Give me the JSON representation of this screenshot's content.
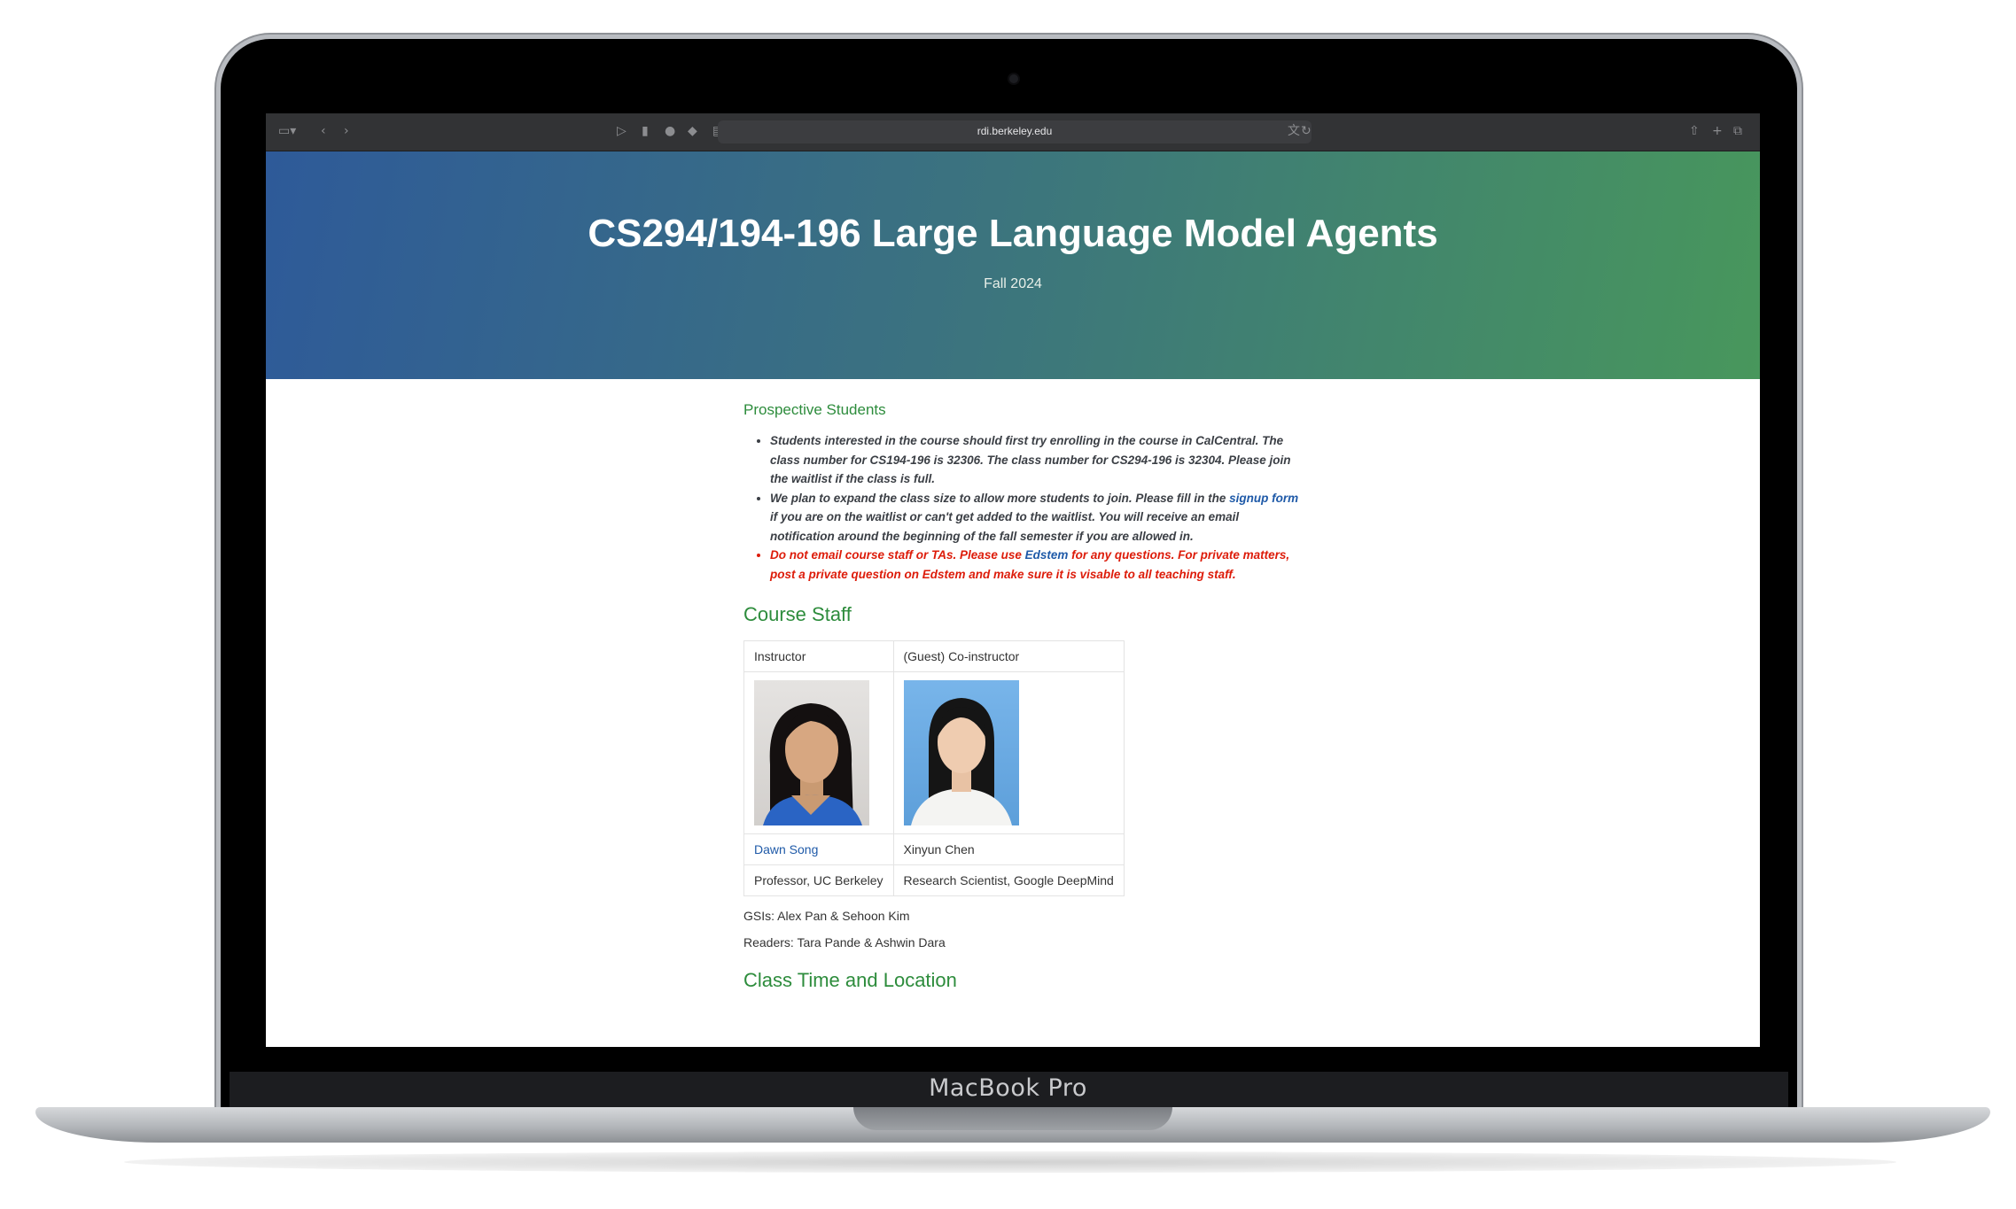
{
  "device": {
    "brand": "MacBook Pro"
  },
  "browser": {
    "url": "rdi.berkeley.edu",
    "icons": [
      "sidebar-icon",
      "chevron-left-icon",
      "chevron-right-icon",
      "tab-icon",
      "page-icon",
      "shield-icon",
      "extension-icon",
      "tab-overview-icon",
      "translate-icon",
      "reload-icon",
      "share-icon",
      "new-tab-icon",
      "tabs-icon"
    ]
  },
  "header": {
    "title": "CS294/194-196 Large Language Model Agents",
    "subtitle": "Fall 2024"
  },
  "prospective": {
    "heading": "Prospective Students",
    "item1": "Students interested in the course should first try enrolling in the course in CalCentral. The class number for CS194-196 is 32306. The class number for CS294-196 is 32304. Please join the waitlist if the class is full.",
    "item2_before": "We plan to expand the class size to allow more students to join. Please fill in the ",
    "item2_link": "signup form",
    "item2_after": " if you are on the waitlist or can't get added to the waitlist. You will receive an email notification around the beginning of the fall semester if you are allowed in.",
    "item3_before": "Do not email course staff or TAs. Please use ",
    "item3_link": "Edstem",
    "item3_after": " for any questions. For private matters, post a private question on Edstem and make sure it is visable to all teaching staff."
  },
  "staff": {
    "heading": "Course Staff",
    "col1_role": "Instructor",
    "col2_role": "(Guest) Co-instructor",
    "col1_name": "Dawn Song",
    "col2_name": "Xinyun Chen",
    "col1_title": "Professor, UC Berkeley",
    "col2_title": "Research Scientist, Google DeepMind",
    "gsis": "GSIs: Alex Pan & Sehoon Kim",
    "readers": "Readers: Tara Pande & Ashwin Dara"
  },
  "class_time": {
    "heading": "Class Time and Location"
  }
}
